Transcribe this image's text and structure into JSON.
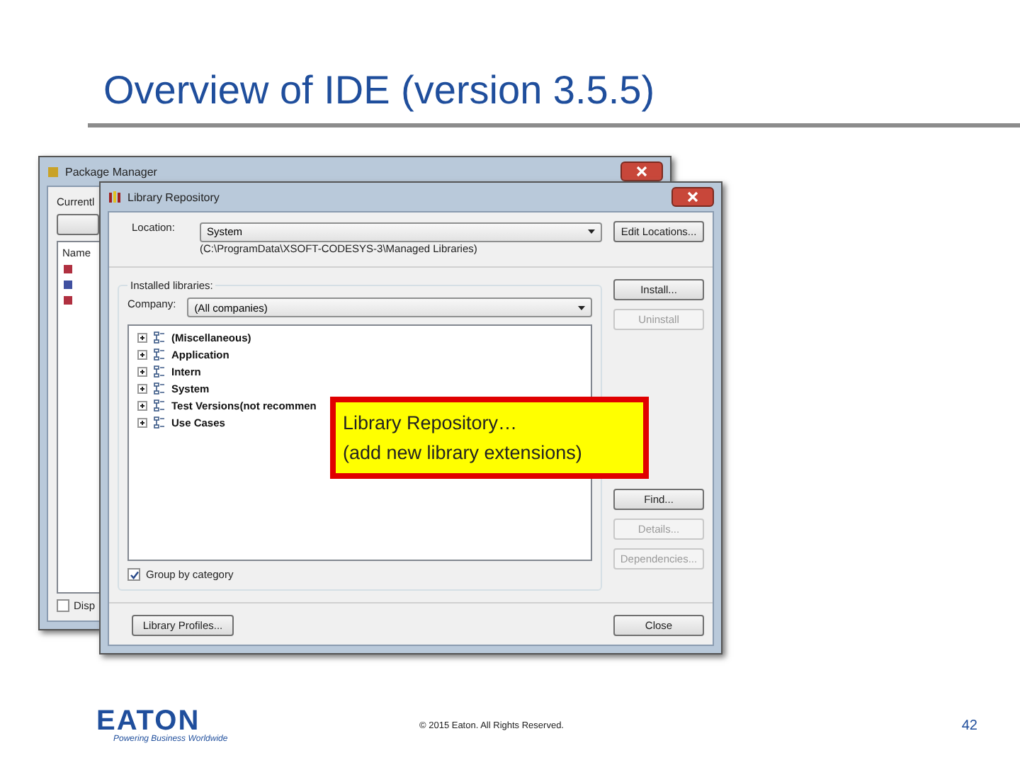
{
  "slide": {
    "title": "Overview of IDE (version 3.5.5)"
  },
  "package_manager": {
    "title": "Package Manager",
    "group_label": "Currentl",
    "column_1": "Name",
    "rows": [
      {
        "color": "#b03040"
      },
      {
        "color": "#4050a0"
      },
      {
        "color": "#b03040"
      }
    ],
    "checkbox": {
      "label": "Disp",
      "checked": false
    }
  },
  "library_repository": {
    "title": "Library Repository",
    "location_label": "Location:",
    "location_value": "System",
    "location_path": "(C:\\ProgramData\\XSOFT-CODESYS-3\\Managed Libraries)",
    "installed_label": "Installed libraries:",
    "company_label": "Company:",
    "company_value": "(All companies)",
    "tree": [
      {
        "label": "(Miscellaneous)",
        "expanded": false
      },
      {
        "label": "Application",
        "expanded": false
      },
      {
        "label": "Intern",
        "expanded": false
      },
      {
        "label": "System",
        "expanded": false
      },
      {
        "label": "Test Versions(not recommen",
        "expanded": false
      },
      {
        "label": "Use Cases",
        "expanded": false
      }
    ],
    "group_by": {
      "label": "Group by category",
      "checked": true
    },
    "side_buttons": [
      {
        "label": "Edit Locations...",
        "disabled": false
      },
      {
        "label": "Install...",
        "disabled": false
      },
      {
        "label": "Uninstall",
        "disabled": true
      },
      {
        "label": "Find...",
        "disabled": false
      },
      {
        "label": "Details...",
        "disabled": true
      },
      {
        "label": "Dependencies...",
        "disabled": true
      }
    ],
    "profiles_button": "Library Profiles...",
    "close_button": "Close"
  },
  "callout": {
    "lines": [
      "Library Repository…",
      "(add new library extensions)"
    ]
  },
  "footer": {
    "logo": "EATON",
    "tagline": "Powering Business Worldwide",
    "copyright": "© 2015 Eaton. All Rights Reserved.",
    "page": "42"
  }
}
